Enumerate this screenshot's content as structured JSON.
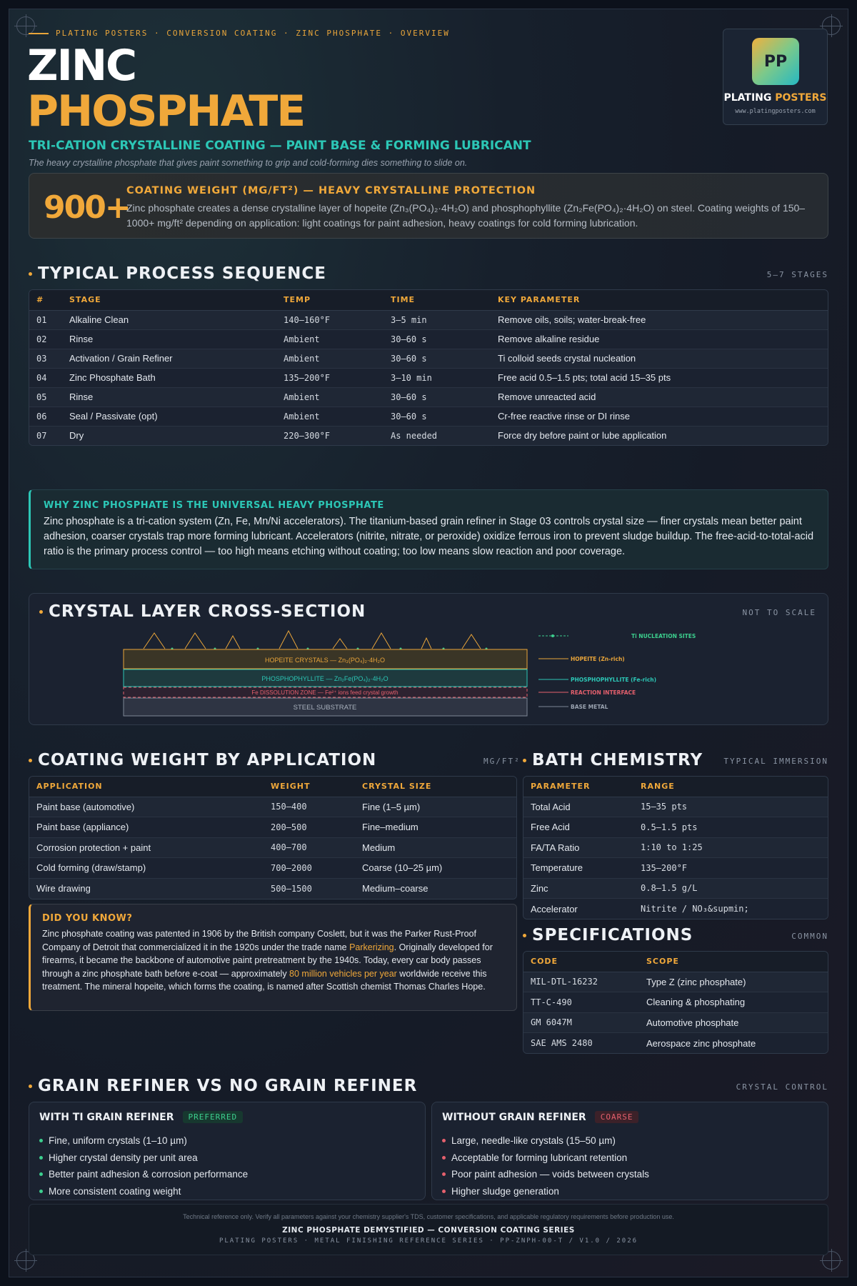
{
  "header": {
    "breadcrumb": "PLATING POSTERS · CONVERSION COATING · ZINC PHOSPHATE · OVERVIEW",
    "title_line1": "ZINC",
    "title_line2": "PHOSPHATE",
    "subtitle": "TRI-CATION CRYSTALLINE COATING — PAINT BASE & FORMING LUBRICANT",
    "tagline": "The heavy crystalline phosphate that gives paint something to grip and cold-forming dies something to slide on."
  },
  "logo": {
    "initials": "PP",
    "name_part1": "PLATING",
    "name_part2": "POSTERS",
    "url": "www.platingposters.com"
  },
  "hero": {
    "value": "900+",
    "heading": "COATING WEIGHT (MG/FT²) — HEAVY CRYSTALLINE PROTECTION",
    "body": "Zinc phosphate creates a dense crystalline layer of hopeite (Zn₃(PO₄)₂·4H₂O) and phosphophyllite (Zn₂Fe(PO₄)₂·4H₂O) on steel. Coating weights of 150–1000+ mg/ft² depending on application: light coatings for paint adhesion, heavy coatings for cold forming lubrication."
  },
  "process": {
    "title": "TYPICAL PROCESS SEQUENCE",
    "note": "5–7 STAGES",
    "columns": [
      "#",
      "STAGE",
      "TEMP",
      "TIME",
      "KEY PARAMETER"
    ],
    "rows": [
      [
        "01",
        "Alkaline Clean",
        "140–160°F",
        "3–5 min",
        "Remove oils, soils; water-break-free"
      ],
      [
        "02",
        "Rinse",
        "Ambient",
        "30–60 s",
        "Remove alkaline residue"
      ],
      [
        "03",
        "Activation / Grain Refiner",
        "Ambient",
        "30–60 s",
        "Ti colloid seeds crystal nucleation"
      ],
      [
        "04",
        "Zinc Phosphate Bath",
        "135–200°F",
        "3–10 min",
        "Free acid 0.5–1.5 pts; total acid 15–35 pts"
      ],
      [
        "05",
        "Rinse",
        "Ambient",
        "30–60 s",
        "Remove unreacted acid"
      ],
      [
        "06",
        "Seal / Passivate (opt)",
        "Ambient",
        "30–60 s",
        "Cr-free reactive rinse or DI rinse"
      ],
      [
        "07",
        "Dry",
        "220–300°F",
        "As needed",
        "Force dry before paint or lube application"
      ]
    ]
  },
  "callout": {
    "heading": "WHY ZINC PHOSPHATE IS THE UNIVERSAL HEAVY PHOSPHATE",
    "body": "Zinc phosphate is a tri-cation system (Zn, Fe, Mn/Ni accelerators). The titanium-based grain refiner in Stage 03 controls crystal size — finer crystals mean better paint adhesion, coarser crystals trap more forming lubricant. Accelerators (nitrite, nitrate, or peroxide) oxidize ferrous iron to prevent sludge buildup. The free-acid-to-total-acid ratio is the primary process control — too high means etching without coating; too low means slow reaction and poor coverage."
  },
  "cross_section": {
    "title": "CRYSTAL LAYER CROSS-SECTION",
    "note": "NOT TO SCALE",
    "layers": {
      "hopeite": "HOPEITE CRYSTALS — Zn₃(PO₄)₂·4H₂O",
      "phosphophyllite": "PHOSPHOPHYLLITE — Zn₂Fe(PO₄)₂·4H₂O",
      "dissolution": "Fe DISSOLUTION ZONE — Fe²⁺ ions feed crystal growth",
      "steel": "STEEL SUBSTRATE"
    },
    "legend": {
      "ti": "Ti NUCLEATION SITES",
      "hopeite": "HOPEITE (Zn-rich)",
      "phosphophyllite": "PHOSPHOPHYLLITE (Fe-rich)",
      "interface": "REACTION INTERFACE",
      "base": "BASE METAL"
    },
    "colors": {
      "hopeite": "#e9a53a",
      "phosphophyllite": "#2cc7b6",
      "interface": "#e5606d",
      "ti": "#3ccf8e",
      "base": "#7d8796"
    }
  },
  "coating_weight": {
    "title": "COATING WEIGHT BY APPLICATION",
    "note": "MG/FT²",
    "columns": [
      "APPLICATION",
      "WEIGHT",
      "CRYSTAL SIZE"
    ],
    "rows": [
      [
        "Paint base (automotive)",
        "150–400",
        "Fine (1–5 µm)"
      ],
      [
        "Paint base (appliance)",
        "200–500",
        "Fine–medium"
      ],
      [
        "Corrosion protection + paint",
        "400–700",
        "Medium"
      ],
      [
        "Cold forming (draw/stamp)",
        "700–2000",
        "Coarse (10–25 µm)"
      ],
      [
        "Wire drawing",
        "500–1500",
        "Medium–coarse"
      ]
    ]
  },
  "bath": {
    "title": "BATH CHEMISTRY",
    "note": "TYPICAL IMMERSION",
    "columns": [
      "PARAMETER",
      "RANGE"
    ],
    "rows": [
      [
        "Total Acid",
        "15–35 pts"
      ],
      [
        "Free Acid",
        "0.5–1.5 pts"
      ],
      [
        "FA/TA Ratio",
        "1:10 to 1:25"
      ],
      [
        "Temperature",
        "135–200°F"
      ],
      [
        "Zinc",
        "0.8–1.5 g/L"
      ],
      [
        "Accelerator",
        "Nitrite / NO₃&supmin;"
      ]
    ]
  },
  "did_you_know": {
    "heading": "DID YOU KNOW?",
    "p1": "Zinc phosphate coating was patented in 1906 by the British company Coslett, but it was the Parker Rust-Proof Company of Detroit that commercialized it in the 1920s under the trade name ",
    "hl1": "Parkerizing",
    "p2": ". Originally developed for firearms, it became the backbone of automotive paint pretreatment by the 1940s. Today, every car body passes through a zinc phosphate bath before e-coat — approximately ",
    "hl2": "80 million vehicles per year",
    "p3": " worldwide receive this treatment. The mineral hopeite, which forms the coating, is named after Scottish chemist Thomas Charles Hope."
  },
  "specs": {
    "title": "SPECIFICATIONS",
    "note": "COMMON",
    "columns": [
      "CODE",
      "SCOPE"
    ],
    "rows": [
      [
        "MIL-DTL-16232",
        "Type Z (zinc phosphate)"
      ],
      [
        "TT-C-490",
        "Cleaning & phosphating"
      ],
      [
        "GM 6047M",
        "Automotive phosphate"
      ],
      [
        "SAE AMS 2480",
        "Aerospace zinc phosphate"
      ]
    ]
  },
  "grain": {
    "title": "GRAIN REFINER VS NO GRAIN REFINER",
    "note": "CRYSTAL CONTROL",
    "with": {
      "title": "WITH TI GRAIN REFINER",
      "tag": "PREFERRED",
      "items": [
        "Fine, uniform crystals (1–10 µm)",
        "Higher crystal density per unit area",
        "Better paint adhesion & corrosion performance",
        "More consistent coating weight"
      ]
    },
    "without": {
      "title": "WITHOUT GRAIN REFINER",
      "tag": "COARSE",
      "items": [
        "Large, needle-like crystals (15–50 µm)",
        "Acceptable for forming lubricant retention",
        "Poor paint adhesion — voids between crystals",
        "Higher sludge generation"
      ]
    }
  },
  "footer": {
    "disclaimer": "Technical reference only. Verify all parameters against your chemistry supplier's TDS, customer specifications, and applicable regulatory requirements before production use.",
    "series": "ZINC PHOSPHATE DEMYSTIFIED — CONVERSION COATING SERIES",
    "ref": "PLATING POSTERS · METAL FINISHING REFERENCE SERIES · PP-ZNPH-00-T / V1.0 / 2026"
  }
}
